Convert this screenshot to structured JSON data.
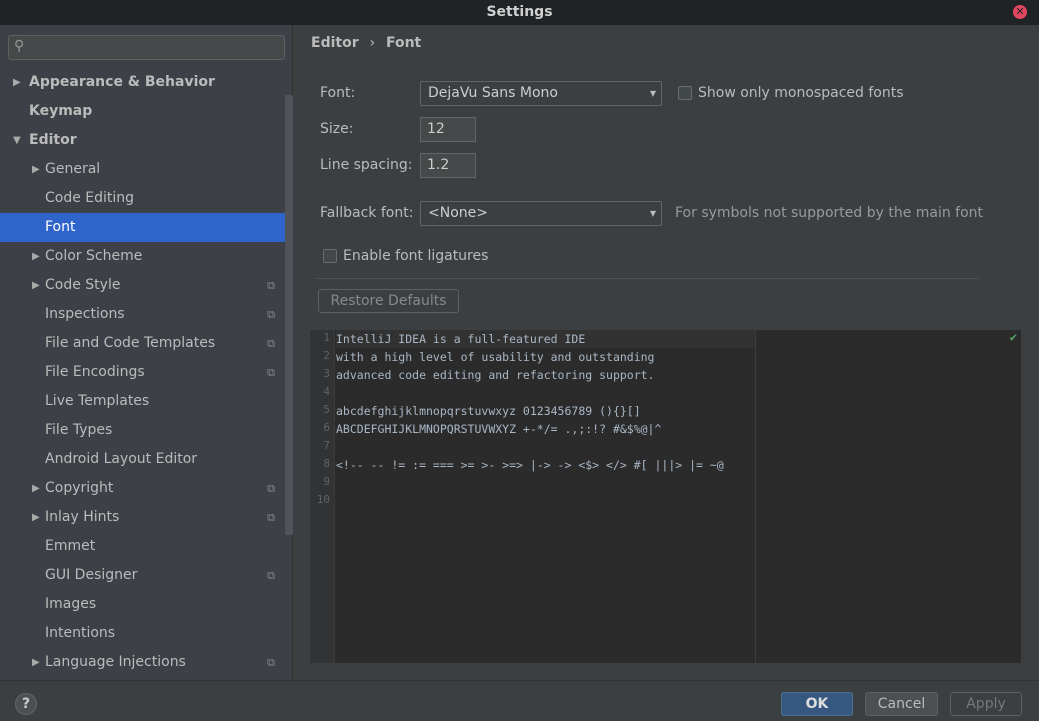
{
  "window": {
    "title": "Settings",
    "close": "✕"
  },
  "sidebar": {
    "search_placeholder": "",
    "items": [
      {
        "label": "Appearance & Behavior",
        "level": 0,
        "bold": true,
        "arrow": "▶"
      },
      {
        "label": "Keymap",
        "level": 0,
        "bold": true,
        "arrow": ""
      },
      {
        "label": "Editor",
        "level": 0,
        "bold": true,
        "arrow": "▼"
      },
      {
        "label": "General",
        "level": 1,
        "arrow": "▶"
      },
      {
        "label": "Code Editing",
        "level": 1,
        "arrow": ""
      },
      {
        "label": "Font",
        "level": 1,
        "arrow": "",
        "selected": true
      },
      {
        "label": "Color Scheme",
        "level": 1,
        "arrow": "▶"
      },
      {
        "label": "Code Style",
        "level": 1,
        "arrow": "▶",
        "copy": true
      },
      {
        "label": "Inspections",
        "level": 1,
        "arrow": "",
        "copy": true
      },
      {
        "label": "File and Code Templates",
        "level": 1,
        "arrow": "",
        "copy": true
      },
      {
        "label": "File Encodings",
        "level": 1,
        "arrow": "",
        "copy": true
      },
      {
        "label": "Live Templates",
        "level": 1,
        "arrow": ""
      },
      {
        "label": "File Types",
        "level": 1,
        "arrow": ""
      },
      {
        "label": "Android Layout Editor",
        "level": 1,
        "arrow": ""
      },
      {
        "label": "Copyright",
        "level": 1,
        "arrow": "▶",
        "copy": true
      },
      {
        "label": "Inlay Hints",
        "level": 1,
        "arrow": "▶",
        "copy": true
      },
      {
        "label": "Emmet",
        "level": 1,
        "arrow": ""
      },
      {
        "label": "GUI Designer",
        "level": 1,
        "arrow": "",
        "copy": true
      },
      {
        "label": "Images",
        "level": 1,
        "arrow": ""
      },
      {
        "label": "Intentions",
        "level": 1,
        "arrow": ""
      },
      {
        "label": "Language Injections",
        "level": 1,
        "arrow": "▶",
        "copy": true
      }
    ]
  },
  "breadcrumb": {
    "parent": "Editor",
    "sep": "›",
    "current": "Font"
  },
  "form": {
    "font_label": "Font:",
    "font_value": "DejaVu Sans Mono",
    "mono_label": "Show only monospaced fonts",
    "size_label": "Size:",
    "size_value": "12",
    "spacing_label": "Line spacing:",
    "spacing_value": "1.2",
    "fallback_label": "Fallback font:",
    "fallback_value": "<None>",
    "fallback_hint": "For symbols not supported by the main font",
    "ligatures_label": "Enable font ligatures",
    "restore": "Restore Defaults"
  },
  "preview": {
    "lines": [
      "IntelliJ IDEA is a full-featured IDE",
      "with a high level of usability and outstanding",
      "advanced code editing and refactoring support.",
      "",
      "abcdefghijklmnopqrstuvwxyz 0123456789 (){}[]",
      "ABCDEFGHIJKLMNOPQRSTUVWXYZ +-*/= .,;:!? #&$%@|^",
      "",
      "<!-- -- != := === >= >- >=> |-> -> <$> </> #[ |||> |= ~@",
      "",
      ""
    ],
    "check": "✔"
  },
  "footer": {
    "help": "?",
    "ok": "OK",
    "cancel": "Cancel",
    "apply": "Apply"
  }
}
